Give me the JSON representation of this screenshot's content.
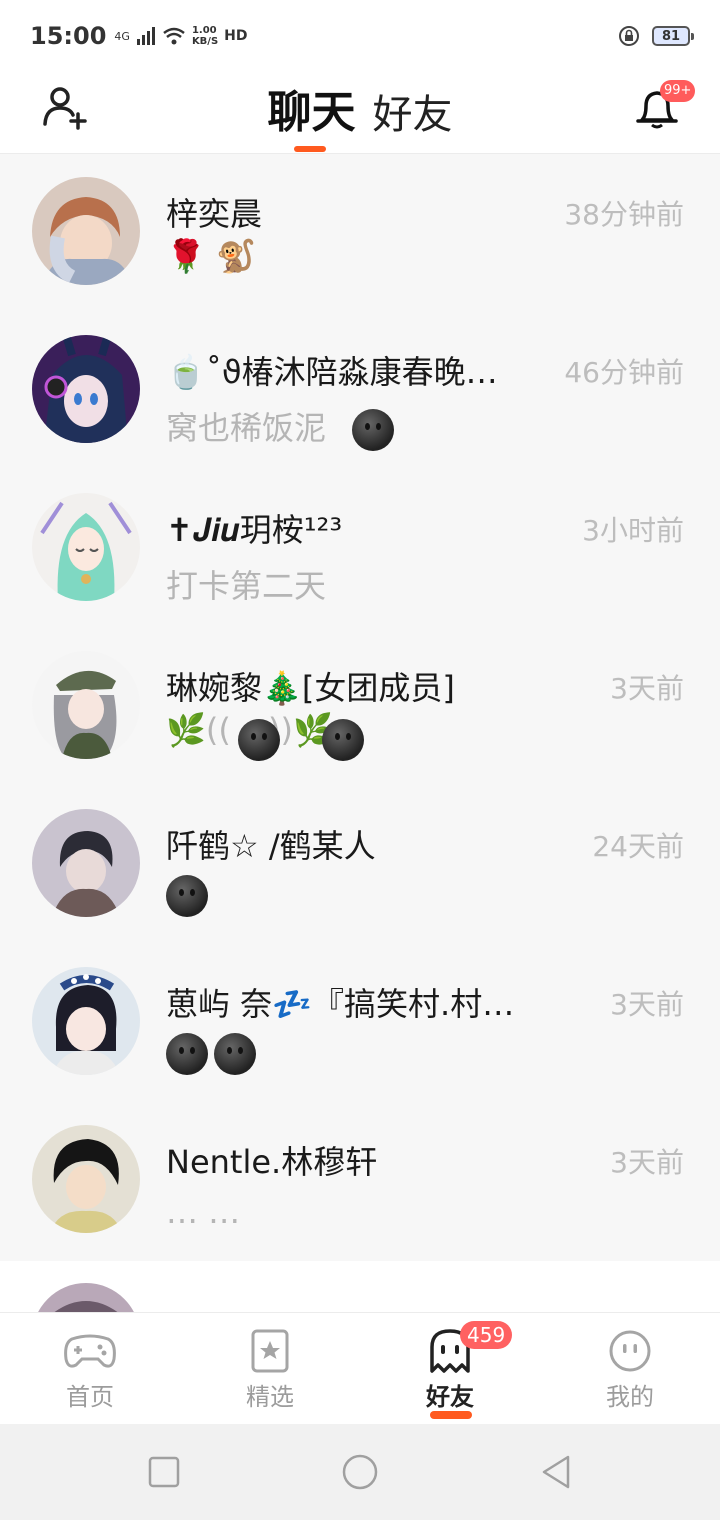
{
  "status_bar": {
    "time": "15:00",
    "network": "4G",
    "speed_value": "1.00",
    "speed_unit": "KB/S",
    "hd": "HD",
    "battery": "81"
  },
  "header": {
    "tabs": [
      "聊天",
      "好友"
    ],
    "active_tab": "聊天",
    "notification_badge": "99+",
    "accent_color": "#ff5a1f"
  },
  "chats": [
    {
      "name": "梓奕晨",
      "time": "38分钟前",
      "preview": "",
      "emojis": "🌹 🐒"
    },
    {
      "name": "🍵˚ϑ椿沐陪淼康春晚…",
      "time": "46分钟前",
      "preview": "窝也稀饭泥",
      "emojis": ""
    },
    {
      "name": "✝𝑱𝒊𝒖玥桉¹²³",
      "time": "3小时前",
      "preview": "打卡第二天",
      "emojis": ""
    },
    {
      "name": "琳婉黎🎄[女团成员]",
      "time": "3天前",
      "preview": "",
      "emojis": "🌿((   ₋   ))🌿"
    },
    {
      "name": "阡鹤☆ /鹤某人",
      "time": "24天前",
      "preview": "",
      "emojis": ""
    },
    {
      "name": "葸屿 奈💤『搞笑村.村…",
      "time": "3天前",
      "preview": "",
      "emojis": ""
    },
    {
      "name": "Nentle.林穆轩",
      "time": "3天前",
      "preview": "… …",
      "emojis": ""
    }
  ],
  "bottom_nav": [
    {
      "label": "首页",
      "icon": "gamepad-icon"
    },
    {
      "label": "精选",
      "icon": "star-card-icon"
    },
    {
      "label": "好友",
      "icon": "ghost-icon",
      "badge": "459"
    },
    {
      "label": "我的",
      "icon": "face-icon"
    }
  ]
}
